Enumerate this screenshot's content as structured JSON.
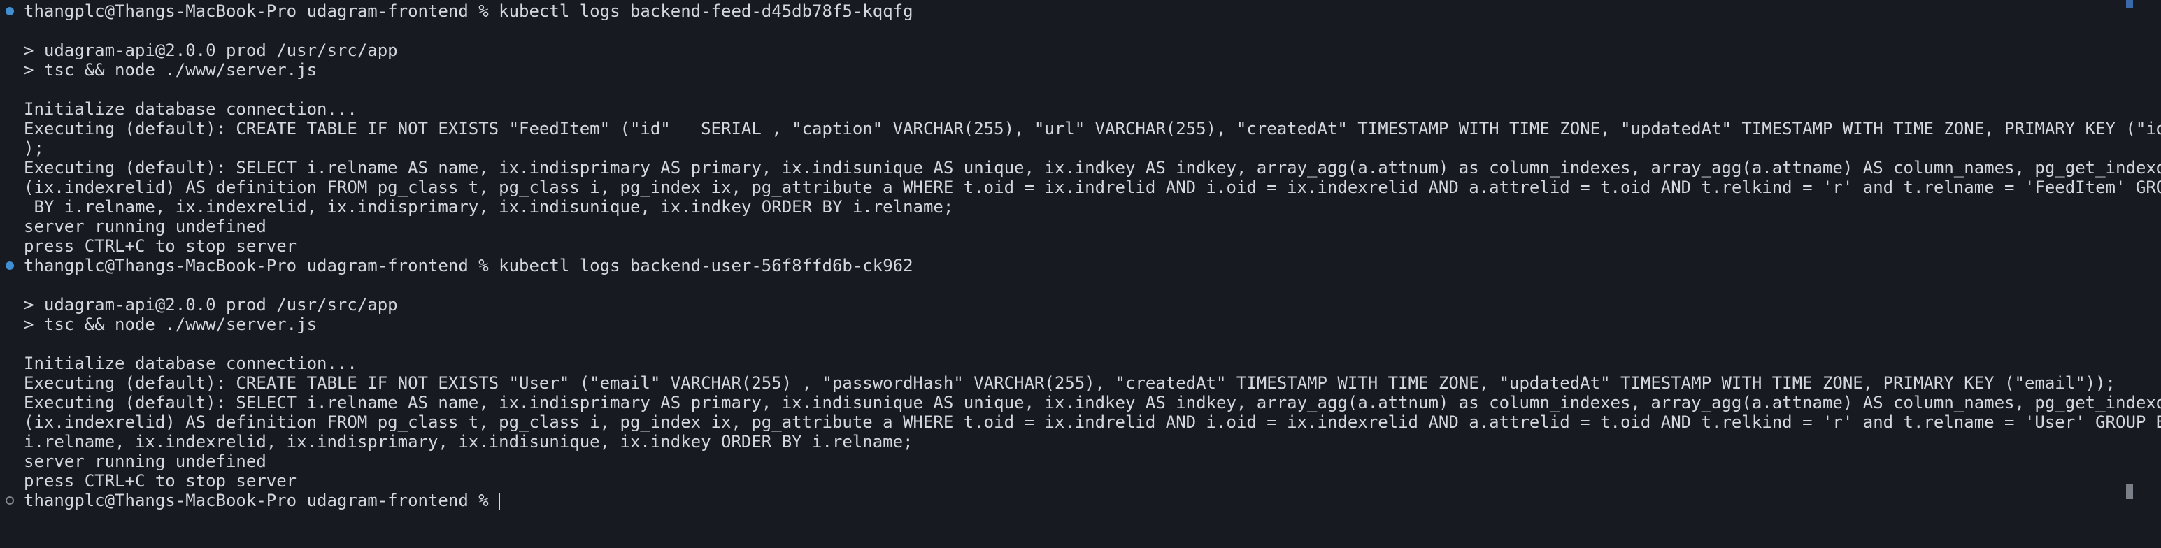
{
  "terminal": {
    "accent_color": "#3f8fd2",
    "background_color": "#181a22",
    "text_color": "#d4d7de",
    "blocks": [
      {
        "status": "done",
        "prompt": "thangplc@Thangs-MacBook-Pro udagram-frontend % ",
        "command": "kubectl logs backend-feed-d45db78f5-kqqfg",
        "output": [
          "",
          "> udagram-api@2.0.0 prod /usr/src/app",
          "> tsc && node ./www/server.js",
          "",
          "Initialize database connection...",
          "Executing (default): CREATE TABLE IF NOT EXISTS \"FeedItem\" (\"id\"   SERIAL , \"caption\" VARCHAR(255), \"url\" VARCHAR(255), \"createdAt\" TIMESTAMP WITH TIME ZONE, \"updatedAt\" TIMESTAMP WITH TIME ZONE, PRIMARY KEY (\"id\"))",
          ");",
          "Executing (default): SELECT i.relname AS name, ix.indisprimary AS primary, ix.indisunique AS unique, ix.indkey AS indkey, array_agg(a.attnum) as column_indexes, array_agg(a.attname) AS column_names, pg_get_indexdef",
          "(ix.indexrelid) AS definition FROM pg_class t, pg_class i, pg_index ix, pg_attribute a WHERE t.oid = ix.indrelid AND i.oid = ix.indexrelid AND a.attrelid = t.oid AND t.relkind = 'r' and t.relname = 'FeedItem' GROUP",
          " BY i.relname, ix.indexrelid, ix.indisprimary, ix.indisunique, ix.indkey ORDER BY i.relname;",
          "server running undefined",
          "press CTRL+C to stop server"
        ]
      },
      {
        "status": "done",
        "prompt": "thangplc@Thangs-MacBook-Pro udagram-frontend % ",
        "command": "kubectl logs backend-user-56f8ffd6b-ck962",
        "output": [
          "",
          "> udagram-api@2.0.0 prod /usr/src/app",
          "> tsc && node ./www/server.js",
          "",
          "Initialize database connection...",
          "Executing (default): CREATE TABLE IF NOT EXISTS \"User\" (\"email\" VARCHAR(255) , \"passwordHash\" VARCHAR(255), \"createdAt\" TIMESTAMP WITH TIME ZONE, \"updatedAt\" TIMESTAMP WITH TIME ZONE, PRIMARY KEY (\"email\"));",
          "Executing (default): SELECT i.relname AS name, ix.indisprimary AS primary, ix.indisunique AS unique, ix.indkey AS indkey, array_agg(a.attnum) as column_indexes, array_agg(a.attname) AS column_names, pg_get_indexdef",
          "(ix.indexrelid) AS definition FROM pg_class t, pg_class i, pg_index ix, pg_attribute a WHERE t.oid = ix.indrelid AND i.oid = ix.indexrelid AND a.attrelid = t.oid AND t.relkind = 'r' and t.relname = 'User' GROUP BY",
          "i.relname, ix.indexrelid, ix.indisprimary, ix.indisunique, ix.indkey ORDER BY i.relname;",
          "server running undefined",
          "press CTRL+C to stop server"
        ]
      },
      {
        "status": "pending",
        "prompt": "thangplc@Thangs-MacBook-Pro udagram-frontend % ",
        "command": "",
        "output": []
      }
    ]
  }
}
